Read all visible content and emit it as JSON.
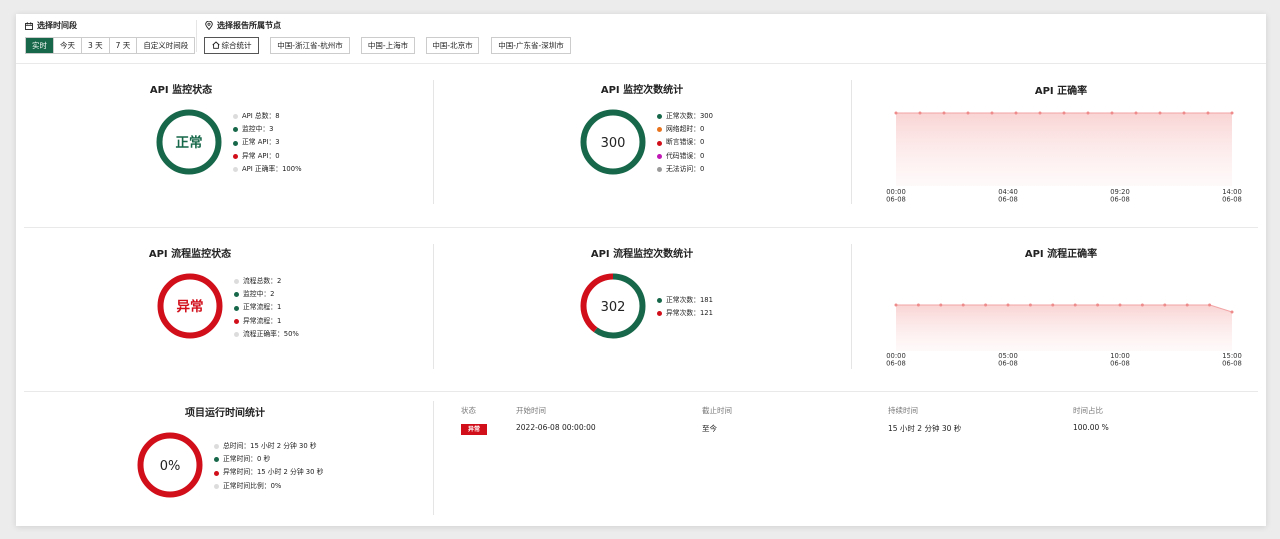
{
  "filters": {
    "time_title": "选择时间段",
    "time_options": [
      "实时",
      "今天",
      "3 天",
      "7 天",
      "自定义时间段"
    ],
    "node_title": "选择报告所属节点",
    "node_options": [
      "综合统计",
      "中国-浙江省-杭州市",
      "中国-上海市",
      "中国-北京市",
      "中国-广东省-深圳市"
    ]
  },
  "api_status": {
    "title": "API 监控状态",
    "center": "正常",
    "center_color": "#17684a",
    "legend": [
      "API 总数：8",
      "监控中：3",
      "正常 API：3",
      "异常 API：0",
      "API 正确率：100%"
    ],
    "legend_colors": [
      "#dcdcdc",
      "#17684a",
      "#17684a",
      "#d10f1b",
      "#dcdcdc"
    ]
  },
  "api_count": {
    "title": "API 监控次数统计",
    "center": "300",
    "legend": [
      "正常次数：300",
      "网络超时：0",
      "断言错误：0",
      "代码错误：0",
      "无法访问：0"
    ],
    "legend_colors": [
      "#17684a",
      "#e8731c",
      "#d10f1b",
      "#c018b5",
      "#9a9a9a"
    ],
    "ring_values": [
      300,
      0,
      0,
      0,
      0
    ]
  },
  "api_rate": {
    "title": "API 正确率",
    "x_labels": [
      [
        "00:00",
        "06-08"
      ],
      [
        "04:40",
        "06-08"
      ],
      [
        "09:20",
        "06-08"
      ],
      [
        "14:00",
        "06-08"
      ]
    ]
  },
  "flow_status": {
    "title": "API 流程监控状态",
    "center": "异常",
    "center_color": "#d10f1b",
    "legend": [
      "流程总数：2",
      "监控中：2",
      "正常流程：1",
      "异常流程：1",
      "流程正确率：50%"
    ],
    "legend_colors": [
      "#dcdcdc",
      "#17684a",
      "#17684a",
      "#d10f1b",
      "#dcdcdc"
    ]
  },
  "flow_count": {
    "title": "API 流程监控次数统计",
    "center": "302",
    "legend": [
      "正常次数：181",
      "异常次数：121"
    ],
    "legend_colors": [
      "#17684a",
      "#d10f1b"
    ],
    "ring_values": [
      181,
      121
    ]
  },
  "flow_rate": {
    "title": "API 流程正确率",
    "x_labels": [
      [
        "00:00",
        "06-08"
      ],
      [
        "05:00",
        "06-08"
      ],
      [
        "10:00",
        "06-08"
      ],
      [
        "15:00",
        "06-08"
      ]
    ]
  },
  "runtime": {
    "title": "项目运行时间统计",
    "center": "0%",
    "legend": [
      "总时间：15 小时 2 分钟 30 秒",
      "正常时间：0 秒",
      "异常时间：15 小时 2 分钟 30 秒",
      "正常时间比例：0%"
    ],
    "legend_colors": [
      "#dcdcdc",
      "#17684a",
      "#d10f1b",
      "#dcdcdc"
    ]
  },
  "table": {
    "headers": [
      "状态",
      "开始时间",
      "截止时间",
      "持续时间",
      "时间占比"
    ],
    "row": {
      "status": "异常",
      "start": "2022-06-08 00:00:00",
      "end": "至今",
      "duration": "15 小时 2 分钟 30 秒",
      "ratio": "100.00 %"
    }
  }
}
